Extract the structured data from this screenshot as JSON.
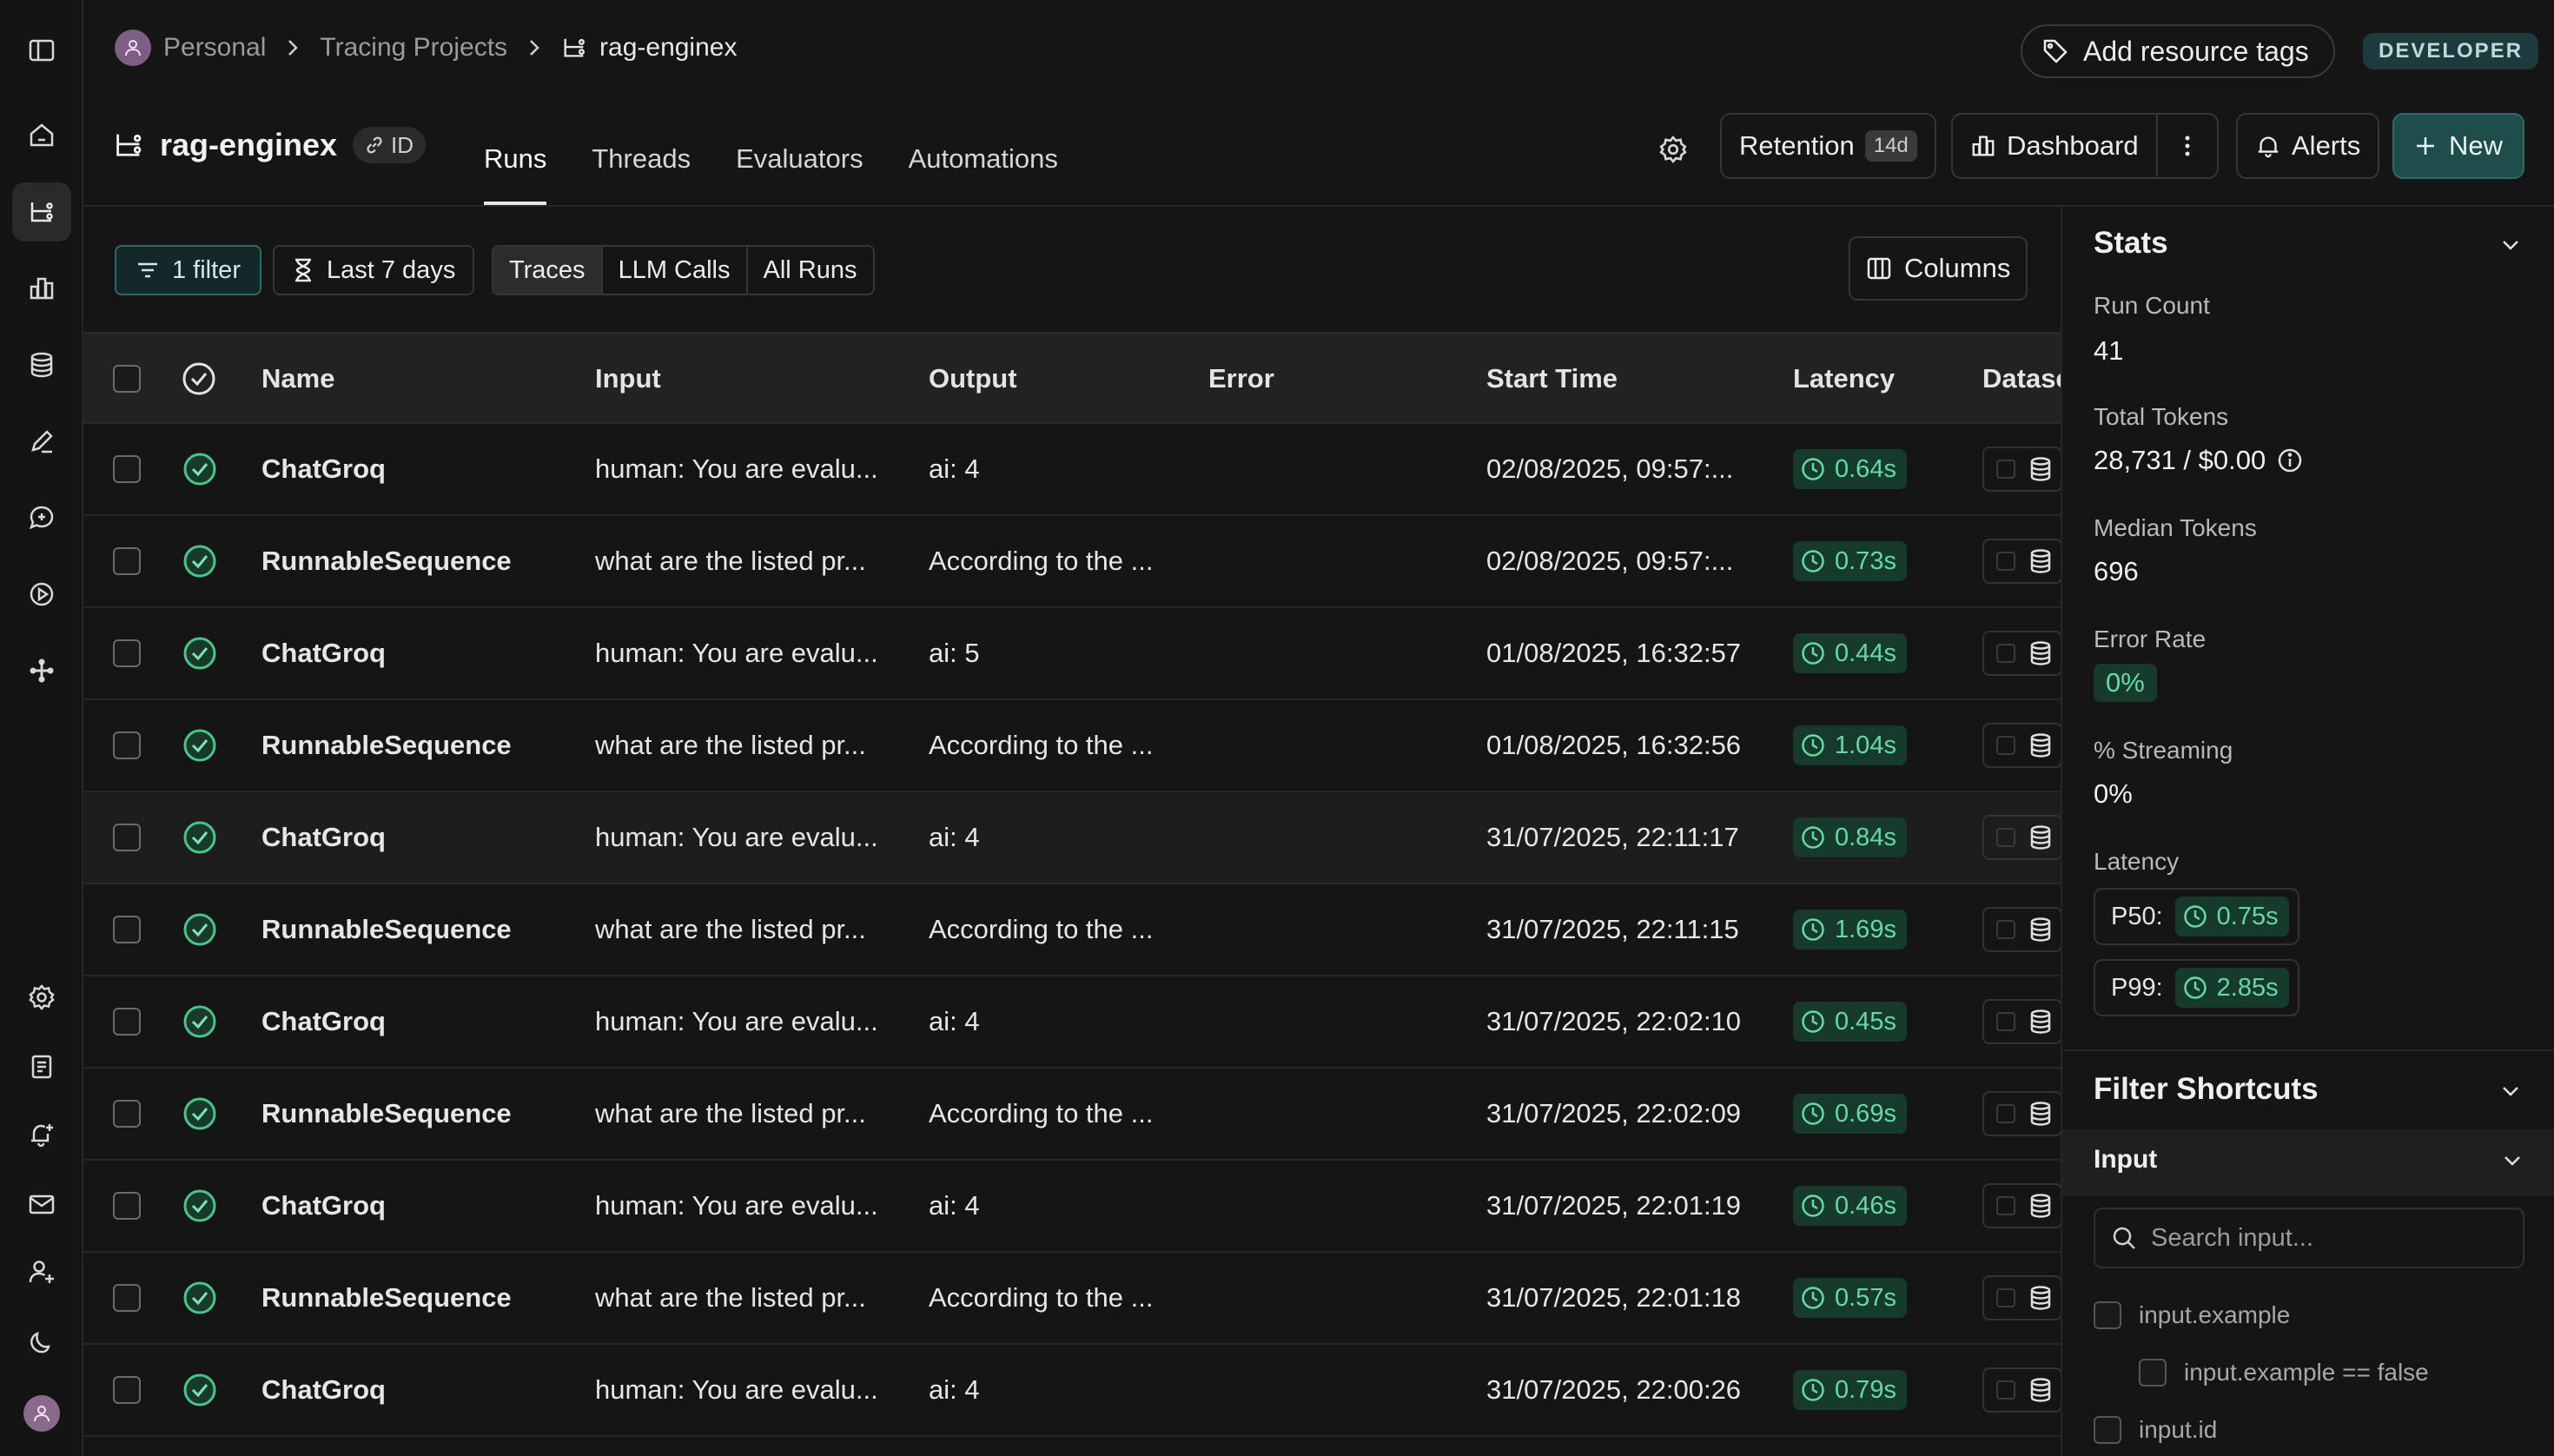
{
  "breadcrumb": {
    "workspace": "Personal",
    "section": "Tracing Projects",
    "project": "rag-enginex"
  },
  "top_actions": {
    "add_tags": "Add resource tags",
    "badge": "DEVELOPER"
  },
  "project": {
    "title": "rag-enginex",
    "id_label": "ID"
  },
  "tabs": [
    {
      "label": "Runs",
      "active": true
    },
    {
      "label": "Threads",
      "active": false
    },
    {
      "label": "Evaluators",
      "active": false
    },
    {
      "label": "Automations",
      "active": false
    }
  ],
  "header_buttons": {
    "retention": "Retention",
    "retention_days": "14d",
    "dashboard": "Dashboard",
    "alerts": "Alerts",
    "new": "New"
  },
  "toolbar": {
    "filter": "1 filter",
    "time_range": "Last 7 days",
    "run_types": [
      "Traces",
      "LLM Calls",
      "All Runs"
    ],
    "active_run_type": "Traces",
    "columns": "Columns"
  },
  "table": {
    "headers": {
      "name": "Name",
      "input": "Input",
      "output": "Output",
      "error": "Error",
      "start_time": "Start Time",
      "latency": "Latency",
      "dataset": "Datase"
    },
    "rows": [
      {
        "name": "ChatGroq",
        "input": "human: You are evalu...",
        "output": "ai: 4",
        "error": "",
        "start": "02/08/2025, 09:57:...",
        "latency": "0.64s"
      },
      {
        "name": "RunnableSequence",
        "input": "what are the listed pr...",
        "output": "According to the ...",
        "error": "",
        "start": "02/08/2025, 09:57:...",
        "latency": "0.73s"
      },
      {
        "name": "ChatGroq",
        "input": "human: You are evalu...",
        "output": "ai: 5",
        "error": "",
        "start": "01/08/2025, 16:32:57",
        "latency": "0.44s"
      },
      {
        "name": "RunnableSequence",
        "input": "what are the listed pr...",
        "output": "According to the ...",
        "error": "",
        "start": "01/08/2025, 16:32:56",
        "latency": "1.04s"
      },
      {
        "name": "ChatGroq",
        "input": "human: You are evalu...",
        "output": "ai: 4",
        "error": "",
        "start": "31/07/2025, 22:11:17",
        "latency": "0.84s"
      },
      {
        "name": "RunnableSequence",
        "input": "what are the listed pr...",
        "output": "According to the ...",
        "error": "",
        "start": "31/07/2025, 22:11:15",
        "latency": "1.69s"
      },
      {
        "name": "ChatGroq",
        "input": "human: You are evalu...",
        "output": "ai: 4",
        "error": "",
        "start": "31/07/2025, 22:02:10",
        "latency": "0.45s"
      },
      {
        "name": "RunnableSequence",
        "input": "what are the listed pr...",
        "output": "According to the ...",
        "error": "",
        "start": "31/07/2025, 22:02:09",
        "latency": "0.69s"
      },
      {
        "name": "ChatGroq",
        "input": "human: You are evalu...",
        "output": "ai: 4",
        "error": "",
        "start": "31/07/2025, 22:01:19",
        "latency": "0.46s"
      },
      {
        "name": "RunnableSequence",
        "input": "what are the listed pr...",
        "output": "According to the ...",
        "error": "",
        "start": "31/07/2025, 22:01:18",
        "latency": "0.57s"
      },
      {
        "name": "ChatGroq",
        "input": "human: You are evalu...",
        "output": "ai: 4",
        "error": "",
        "start": "31/07/2025, 22:00:26",
        "latency": "0.79s"
      }
    ]
  },
  "stats": {
    "title": "Stats",
    "run_count_label": "Run Count",
    "run_count": "41",
    "total_tokens_label": "Total Tokens",
    "total_tokens": "28,731 / $0.00",
    "median_tokens_label": "Median Tokens",
    "median_tokens": "696",
    "error_rate_label": "Error Rate",
    "error_rate": "0%",
    "streaming_label": "% Streaming",
    "streaming": "0%",
    "latency_label": "Latency",
    "p50_label": "P50:",
    "p50": "0.75s",
    "p99_label": "P99:",
    "p99": "2.85s"
  },
  "filter_shortcuts": {
    "title": "Filter Shortcuts",
    "group": "Input",
    "search_placeholder": "Search input...",
    "options": [
      "input.example",
      "input.example == false",
      "input.id"
    ]
  },
  "colors": {
    "accent_teal": "#1f4d4c",
    "success_green": "#67d8a3",
    "success_bg": "#163b2c",
    "background": "#151515"
  },
  "icons": [
    "sidebar-toggle-icon",
    "home-icon",
    "tracing-icon",
    "bar-chart-icon",
    "database-icon",
    "pen-icon",
    "chat-icon",
    "play-icon",
    "network-icon",
    "settings-icon",
    "document-icon",
    "bell-plus-icon",
    "mail-icon",
    "user-plus-icon",
    "moon-icon"
  ]
}
